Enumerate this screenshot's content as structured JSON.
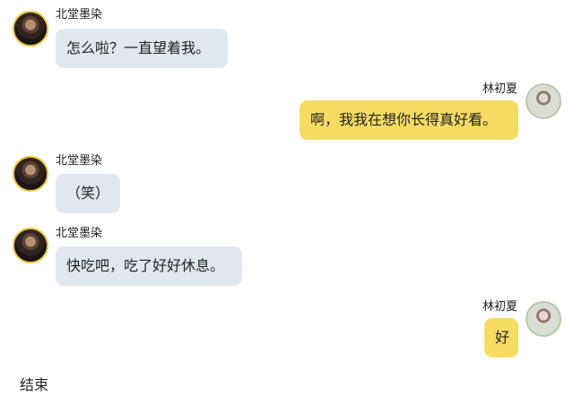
{
  "messages": [
    {
      "speaker": "北堂墨染",
      "text": "怎么啦？一直望着我。"
    },
    {
      "speaker": "林初夏",
      "text": "啊，我我在想你长得真好看。"
    },
    {
      "speaker": "北堂墨染",
      "text": "（笑）"
    },
    {
      "speaker": "北堂墨染",
      "text": "快吃吧，吃了好好休息。"
    },
    {
      "speaker": "林初夏",
      "text": "好"
    }
  ],
  "footer": {
    "text": "结束"
  },
  "colors": {
    "left_bubble": "#e1e7ef",
    "right_bubble": "#f7dc63",
    "text": "#222222"
  }
}
